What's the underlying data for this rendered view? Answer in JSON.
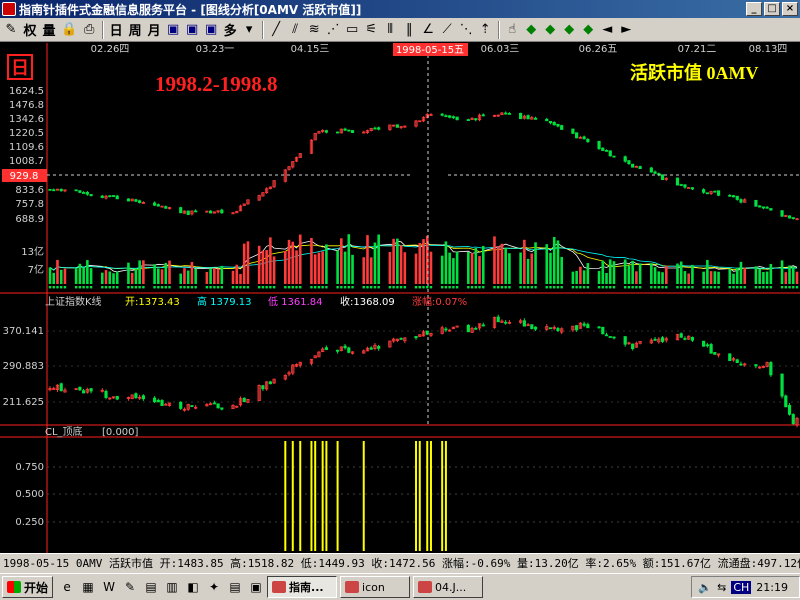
{
  "window": {
    "title": "指南针插件式金融信息服务平台 - [图线分析[0AMV 活跃市值]]"
  },
  "toolbar": {
    "buttons": [
      {
        "name": "draw-tool-icon",
        "glyph": "✎",
        "kind": ""
      },
      {
        "name": "weight-button",
        "glyph": "权",
        "kind": "txt"
      },
      {
        "name": "volume-button",
        "glyph": "量",
        "kind": "txt"
      },
      {
        "name": "lock-icon",
        "glyph": "🔒",
        "kind": ""
      },
      {
        "name": "print-icon",
        "glyph": "⎙",
        "kind": ""
      },
      {
        "name": "sep",
        "glyph": "",
        "kind": "sep"
      },
      {
        "name": "day-period-button",
        "glyph": "日",
        "kind": "txt"
      },
      {
        "name": "week-period-button",
        "glyph": "周",
        "kind": "txt"
      },
      {
        "name": "month-period-button",
        "glyph": "月",
        "kind": "txt"
      },
      {
        "name": "window-icon-1",
        "glyph": "▣",
        "kind": "blue"
      },
      {
        "name": "window-icon-2",
        "glyph": "▣",
        "kind": "blue"
      },
      {
        "name": "window-icon-3",
        "glyph": "▣",
        "kind": "blue"
      },
      {
        "name": "multi-button",
        "glyph": "多",
        "kind": "txt"
      },
      {
        "name": "dropdown-arrow-icon",
        "glyph": "▾",
        "kind": ""
      },
      {
        "name": "sep",
        "glyph": "",
        "kind": "sep"
      },
      {
        "name": "line-tool-icon",
        "glyph": "╱",
        "kind": ""
      },
      {
        "name": "parallel-line-icon",
        "glyph": "⫽",
        "kind": ""
      },
      {
        "name": "channel-line-icon",
        "glyph": "≋",
        "kind": ""
      },
      {
        "name": "ray-line-icon",
        "glyph": "⋰",
        "kind": ""
      },
      {
        "name": "rectangle-tool-icon",
        "glyph": "▭",
        "kind": ""
      },
      {
        "name": "fan-line-icon",
        "glyph": "⚟",
        "kind": ""
      },
      {
        "name": "cycle-line-icon",
        "glyph": "⦀",
        "kind": ""
      },
      {
        "name": "fibonacci-icon",
        "glyph": "‖",
        "kind": ""
      },
      {
        "name": "angle-line-icon",
        "glyph": "∠",
        "kind": ""
      },
      {
        "name": "gann-line-icon",
        "glyph": "⟋",
        "kind": ""
      },
      {
        "name": "speed-line-icon",
        "glyph": "⋱",
        "kind": ""
      },
      {
        "name": "arrow-up-icon",
        "glyph": "⇡",
        "kind": ""
      },
      {
        "name": "sep",
        "glyph": "",
        "kind": "sep"
      },
      {
        "name": "pointer-icon",
        "glyph": "☝",
        "kind": ""
      },
      {
        "name": "diamond-left-icon",
        "glyph": "◆",
        "kind": "green"
      },
      {
        "name": "diamond-icon-2",
        "glyph": "◆",
        "kind": "green"
      },
      {
        "name": "diamond-icon-3",
        "glyph": "◆",
        "kind": "green"
      },
      {
        "name": "diamond-icon-4",
        "glyph": "◆",
        "kind": "green"
      },
      {
        "name": "arrow-left-icon",
        "glyph": "◄",
        "kind": ""
      },
      {
        "name": "arrow-right-icon",
        "glyph": "►",
        "kind": ""
      }
    ]
  },
  "chart_labels": {
    "date_labels": [
      "02.26四",
      "03.23一",
      "04.15三",
      "06.03三",
      "06.26五",
      "07.21二",
      "08.13四"
    ],
    "cursor_date": "1998-05-15五",
    "period_badge": "日",
    "date_range_caption": "1998.2-1998.8",
    "index_name": "活跃市值 0AMV",
    "price_ticks": [
      "1624.5",
      "1476.8",
      "1342.6",
      "1220.5",
      "1109.6",
      "1008.7",
      "929.8",
      "833.6",
      "757.8",
      "688.9"
    ],
    "cursor_price": "929.8",
    "volume_ticks": [
      "13亿",
      "7亿"
    ],
    "index_title": "上证指数K线",
    "index_open_label": "开:1373.43",
    "index_high_label": "高 1379.13",
    "index_low_label": "低 1361.84",
    "index_close_label": "收:1368.09",
    "index_change_label": "涨幅:0.07%",
    "index_ticks": [
      "370.141",
      "290.883",
      "211.625"
    ],
    "indicator_title": "CL_顶底",
    "indicator_value": "[0.000]",
    "indicator_ticks": [
      "0.750",
      "0.500",
      "0.250"
    ]
  },
  "colors": {
    "up": "#ff3b3b",
    "down": "#00e040",
    "cursor_label": "#ff3030",
    "caption": "#ff2020",
    "index_name": "#ffff00",
    "tick": "#d0d0d0",
    "grid": "#ff2020",
    "signal": "#ffff00"
  },
  "chart_data": {
    "type": "candlestick",
    "series": [
      {
        "name": "活跃市值 0AMV",
        "x_range": [
          "1998-02",
          "1998-08"
        ],
        "y_range": [
          688.9,
          1624.5
        ],
        "cursor": {
          "date": "1998-05-15",
          "value": 929.8
        },
        "approx_close_path": [
          {
            "x": "1998-02-05",
            "y": 905
          },
          {
            "x": "1998-02-26",
            "y": 820
          },
          {
            "x": "1998-03-10",
            "y": 735
          },
          {
            "x": "1998-03-23",
            "y": 740
          },
          {
            "x": "1998-04-02",
            "y": 930
          },
          {
            "x": "1998-04-15",
            "y": 1335
          },
          {
            "x": "1998-04-27",
            "y": 1330
          },
          {
            "x": "1998-05-08",
            "y": 1380
          },
          {
            "x": "1998-05-15",
            "y": 1450
          },
          {
            "x": "1998-05-25",
            "y": 1420
          },
          {
            "x": "1998-06-03",
            "y": 1460
          },
          {
            "x": "1998-06-15",
            "y": 1395
          },
          {
            "x": "1998-06-26",
            "y": 1250
          },
          {
            "x": "1998-07-08",
            "y": 1080
          },
          {
            "x": "1998-07-21",
            "y": 935
          },
          {
            "x": "1998-08-04",
            "y": 845
          },
          {
            "x": "1998-08-13",
            "y": 760
          },
          {
            "x": "1998-08-20",
            "y": 690
          }
        ]
      },
      {
        "name": "上证指数K线",
        "y_ticks": [
          370.141,
          290.883,
          211.625
        ],
        "last_bar": {
          "open": 1373.43,
          "high": 1379.13,
          "low": 1361.84,
          "close": 1368.09,
          "change_pct": 0.07
        },
        "approx_close_path": [
          {
            "x": "1998-02-05",
            "y": 245
          },
          {
            "x": "1998-02-26",
            "y": 225
          },
          {
            "x": "1998-03-10",
            "y": 210
          },
          {
            "x": "1998-03-23",
            "y": 210
          },
          {
            "x": "1998-04-02",
            "y": 260
          },
          {
            "x": "1998-04-15",
            "y": 318
          },
          {
            "x": "1998-04-27",
            "y": 325
          },
          {
            "x": "1998-05-08",
            "y": 345
          },
          {
            "x": "1998-05-15",
            "y": 360
          },
          {
            "x": "1998-05-25",
            "y": 365
          },
          {
            "x": "1998-06-03",
            "y": 385
          },
          {
            "x": "1998-06-15",
            "y": 362
          },
          {
            "x": "1998-06-26",
            "y": 372
          },
          {
            "x": "1998-07-08",
            "y": 330
          },
          {
            "x": "1998-07-21",
            "y": 350
          },
          {
            "x": "1998-08-04",
            "y": 300
          },
          {
            "x": "1998-08-13",
            "y": 290
          },
          {
            "x": "1998-08-20",
            "y": 180
          }
        ]
      },
      {
        "name": "volume",
        "unit": "亿",
        "y_ticks": [
          7,
          13
        ]
      },
      {
        "name": "CL_顶底",
        "type": "bar",
        "y_ticks": [
          0.25,
          0.5,
          0.75
        ],
        "signals": [
          "1998-04-06",
          "1998-04-08",
          "1998-04-10",
          "1998-04-13",
          "1998-04-14",
          "1998-04-16",
          "1998-04-17",
          "1998-04-20",
          "1998-04-27",
          "1998-05-11",
          "1998-05-12",
          "1998-05-14",
          "1998-05-15",
          "1998-05-18",
          "1998-05-19"
        ],
        "signal_value": 1.0
      }
    ]
  },
  "statusbar": {
    "text": "1998-05-15 0AMV 活跃市值 开:1483.85 高:1518.82 低:1449.93 收:1472.56 涨幅:-0.69% 量:13.20亿 率:2.65% 额:151.67亿 流通盘:497.12亿"
  },
  "taskbar": {
    "start_label": "开始",
    "quicklaunch": [
      "ie-icon",
      "desktop-icon",
      "word-icon",
      "paint-icon",
      "app-icon-1",
      "app-icon-2",
      "app-icon-3",
      "app-icon-4",
      "app-icon-5",
      "app-icon-6"
    ],
    "tasks": [
      {
        "label": "指南...",
        "active": true
      },
      {
        "label": "icon",
        "active": false
      },
      {
        "label": "04.J...",
        "active": false
      }
    ],
    "tray_time": "21:19",
    "tray_lang": "CH"
  }
}
